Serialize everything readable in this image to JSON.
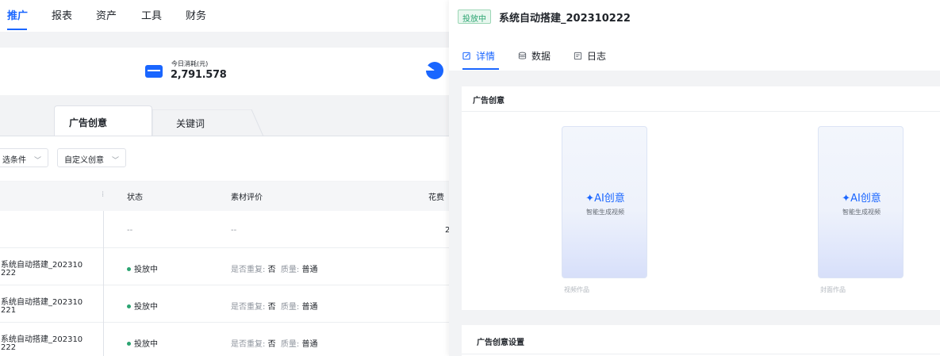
{
  "topnav": {
    "items": [
      {
        "label": "推广",
        "active": true
      },
      {
        "label": "报表"
      },
      {
        "label": "资产"
      },
      {
        "label": "工具"
      },
      {
        "label": "财务"
      }
    ]
  },
  "stats": {
    "spend_label": "今日消耗(元)",
    "spend_value": "2,791.578"
  },
  "tabs": {
    "creative": "广告创意",
    "keyword": "关键词"
  },
  "filters": {
    "filter1": "选条件",
    "filter2": "自定义创意"
  },
  "table": {
    "headers": {
      "status": "状态",
      "material": "素材评价",
      "cost": "花费"
    },
    "summary": {
      "status": "--",
      "material": "--",
      "cost_fragment": "2"
    },
    "rows": [
      {
        "name_line1": "系统自动搭建_202310",
        "name_line2": "222",
        "status": "投放中",
        "dup_label": "是否重复:",
        "dup_value": "否",
        "quality_label": "质量:",
        "quality_value": "普通"
      },
      {
        "name_line1": "系统自动搭建_202310",
        "name_line2": "221",
        "status": "投放中",
        "dup_label": "是否重复:",
        "dup_value": "否",
        "quality_label": "质量:",
        "quality_value": "普通"
      },
      {
        "name_line1": "系统自动搭建_202310",
        "name_line2": "222",
        "status": "投放中",
        "dup_label": "是否重复:",
        "dup_value": "否",
        "quality_label": "质量:",
        "quality_value": "普通"
      }
    ]
  },
  "panel": {
    "status_tag": "投放中",
    "title": "系统自动搭建_202310222",
    "tabs": {
      "detail": "详情",
      "data": "数据",
      "log": "日志"
    },
    "creative_section": {
      "title": "广告创意",
      "items": [
        {
          "ai_title": "AI创意",
          "ai_sub": "智能生成视频",
          "caption": "视频作品"
        },
        {
          "ai_title": "AI创意",
          "ai_sub": "智能生成视频",
          "caption": "封面作品"
        }
      ]
    },
    "settings_section": {
      "title": "广告创意设置"
    }
  },
  "colors": {
    "accent": "#1a66ff",
    "success": "#2ba471"
  }
}
